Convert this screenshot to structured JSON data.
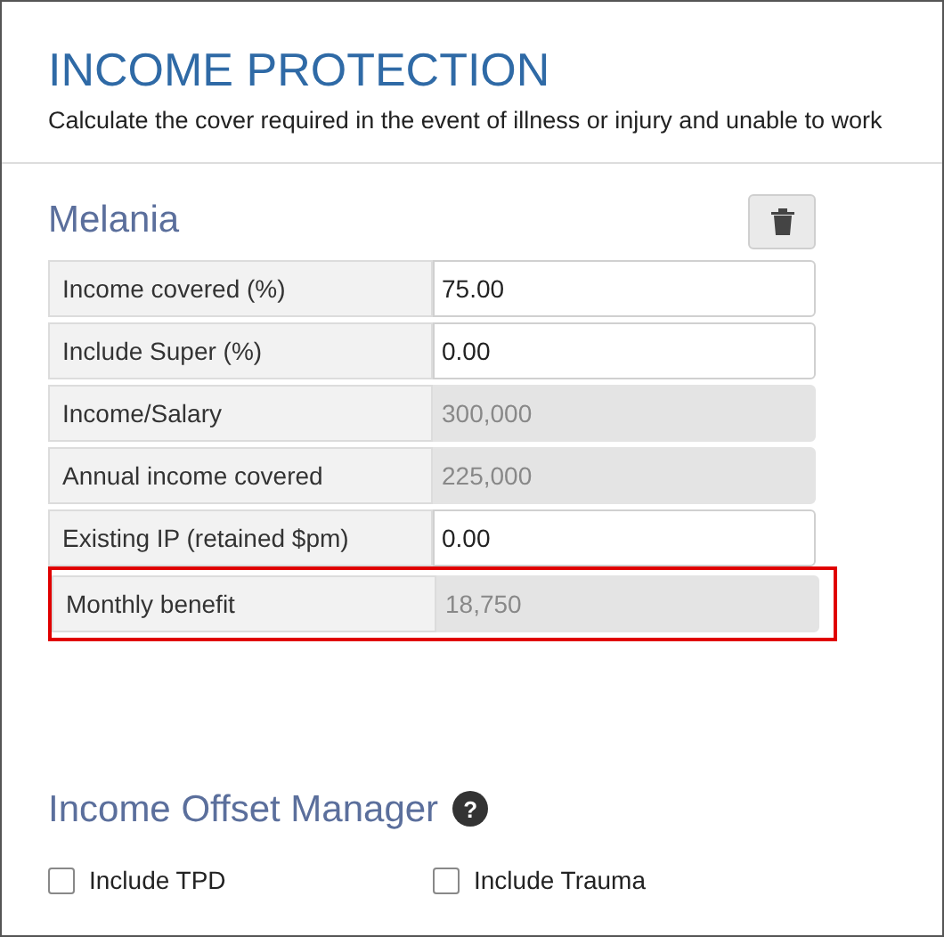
{
  "header": {
    "title": "INCOME PROTECTION",
    "subtitle": "Calculate the cover required in the event of illness or injury and unable to work"
  },
  "person": {
    "name": "Melania"
  },
  "rows": [
    {
      "label": "Income covered (%)",
      "value": "75.00",
      "readonly": false,
      "highlighted": false
    },
    {
      "label": "Include Super (%)",
      "value": "0.00",
      "readonly": false,
      "highlighted": false
    },
    {
      "label": "Income/Salary",
      "value": "300,000",
      "readonly": true,
      "highlighted": false
    },
    {
      "label": "Annual income covered",
      "value": "225,000",
      "readonly": true,
      "highlighted": false
    },
    {
      "label": "Existing IP (retained $pm)",
      "value": "0.00",
      "readonly": false,
      "highlighted": false
    },
    {
      "label": "Monthly benefit",
      "value": "18,750",
      "readonly": true,
      "highlighted": true
    }
  ],
  "offset_manager": {
    "title": "Income Offset Manager",
    "help": "?",
    "options": [
      {
        "label": "Include TPD",
        "checked": false
      },
      {
        "label": "Include Trauma",
        "checked": false
      }
    ]
  }
}
